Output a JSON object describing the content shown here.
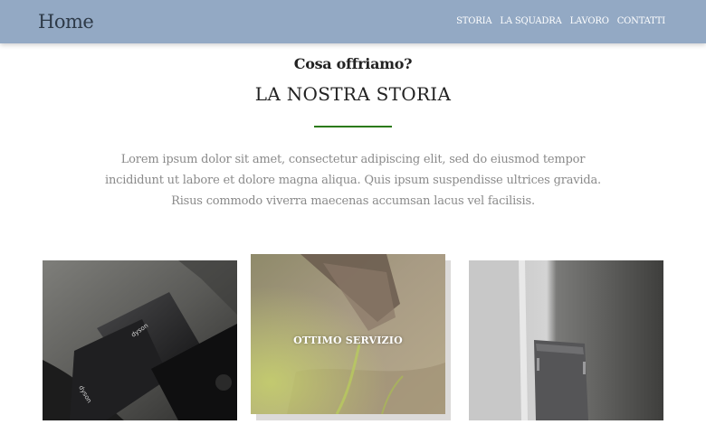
{
  "header": {
    "brand": "Home",
    "nav": [
      "STORIA",
      "LA SQUADRA",
      "LAVORO",
      "CONTATTI"
    ]
  },
  "section": {
    "subtitle": "Cosa offriamo?",
    "title": "LA NOSTRA STORIA",
    "text": "Lorem ipsum dolor sit amet, consectetur adipiscing elit, sed do eiusmod tempor incididunt ut labore et dolore magna aliqua. Quis ipsum suspendisse ultrices gravida. Risus commodo viverra maecenas accumsan lacus vel facilisis."
  },
  "cards": [
    {
      "caption": "",
      "image": "dyson-hair-dryer-photo"
    },
    {
      "caption": "OTTIMO SERVIZIO",
      "image": "leather-stamp-photo"
    },
    {
      "caption": "",
      "image": "dyson-device-photo"
    }
  ],
  "colors": {
    "navbar": "#93a9c4",
    "accent": "#2a7a10"
  }
}
